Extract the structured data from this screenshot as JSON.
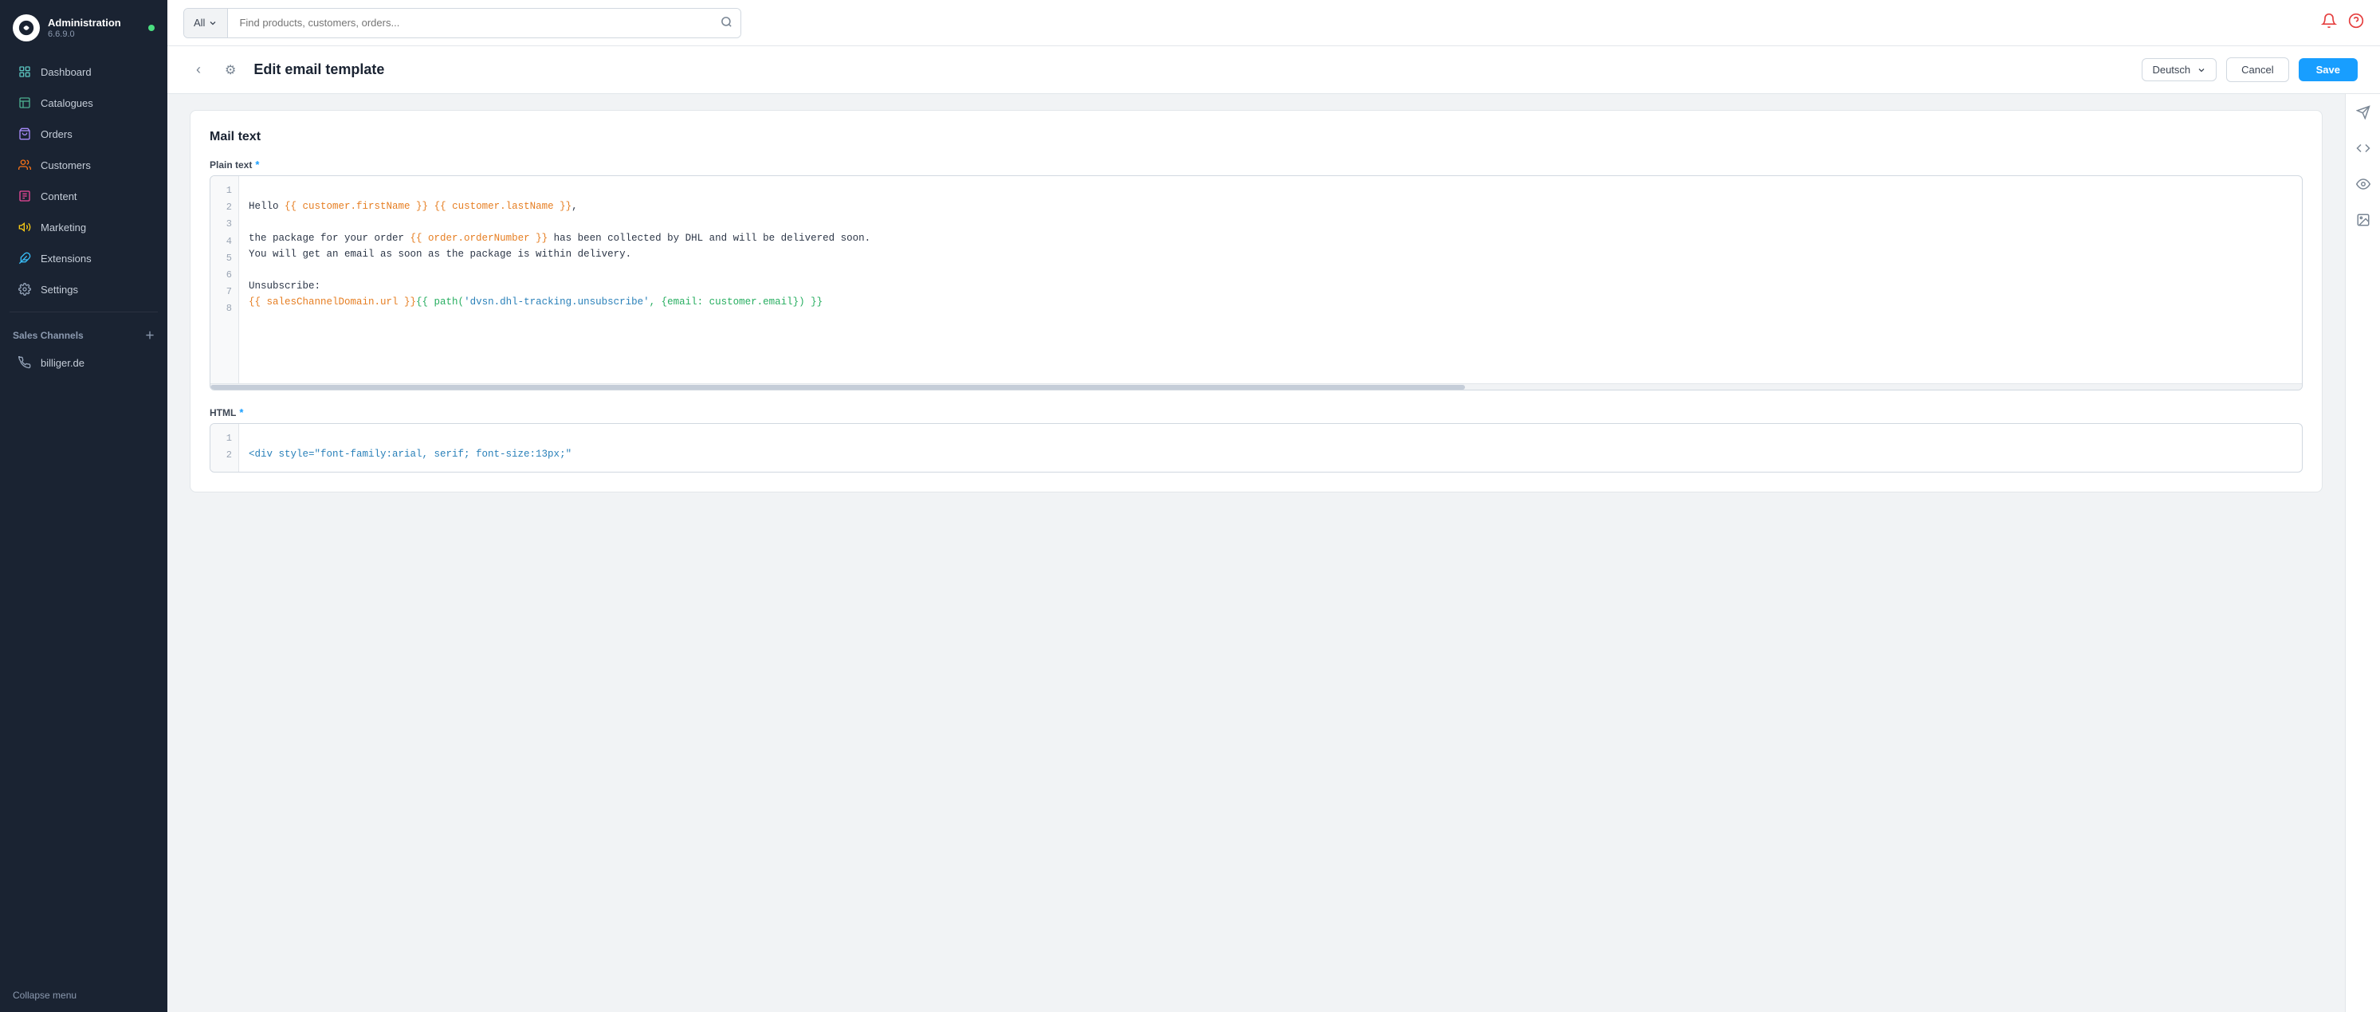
{
  "app": {
    "name": "Administration",
    "version": "6.6.9.0"
  },
  "topbar": {
    "search_filter": "All",
    "search_placeholder": "Find products, customers, orders...",
    "chevron": "▾"
  },
  "page_header": {
    "back_label": "‹",
    "settings_label": "⚙",
    "title": "Edit email template",
    "language": "Deutsch",
    "cancel_label": "Cancel",
    "save_label": "Save"
  },
  "sidebar": {
    "nav_items": [
      {
        "id": "dashboard",
        "label": "Dashboard",
        "icon": "dashboard"
      },
      {
        "id": "catalogues",
        "label": "Catalogues",
        "icon": "catalogues"
      },
      {
        "id": "orders",
        "label": "Orders",
        "icon": "orders"
      },
      {
        "id": "customers",
        "label": "Customers",
        "icon": "customers"
      },
      {
        "id": "content",
        "label": "Content",
        "icon": "content"
      },
      {
        "id": "marketing",
        "label": "Marketing",
        "icon": "marketing"
      },
      {
        "id": "extensions",
        "label": "Extensions",
        "icon": "extensions"
      },
      {
        "id": "settings",
        "label": "Settings",
        "icon": "settings"
      }
    ],
    "sales_channels_label": "Sales Channels",
    "sales_channel_items": [
      {
        "id": "billiger",
        "label": "billiger.de"
      }
    ],
    "collapse_label": "Collapse menu"
  },
  "mail_text": {
    "card_title": "Mail text",
    "plain_text_label": "Plain text",
    "html_label": "HTML",
    "required_marker": "*",
    "plain_text_lines": [
      {
        "num": 1,
        "content": ""
      },
      {
        "num": 2,
        "content": "Hello {{ customer.firstName }} {{ customer.lastName }},"
      },
      {
        "num": 3,
        "content": ""
      },
      {
        "num": 4,
        "content": "the package for your order {{ order.orderNumber }} has been collected by DHL and will be delivered soon."
      },
      {
        "num": 5,
        "content": "You will get an email as soon as the package is within delivery."
      },
      {
        "num": 6,
        "content": ""
      },
      {
        "num": 7,
        "content": "Unsubscribe:"
      },
      {
        "num": 8,
        "content": "{{ salesChannelDomain.url }}{{ path('dvsn.dhl-tracking.unsubscribe', {email: customer.email}) }}"
      }
    ],
    "html_lines": [
      {
        "num": 1,
        "content": ""
      },
      {
        "num": 2,
        "content": "<div style=\"font-family:arial, serif; font-size:13px;\""
      }
    ]
  }
}
